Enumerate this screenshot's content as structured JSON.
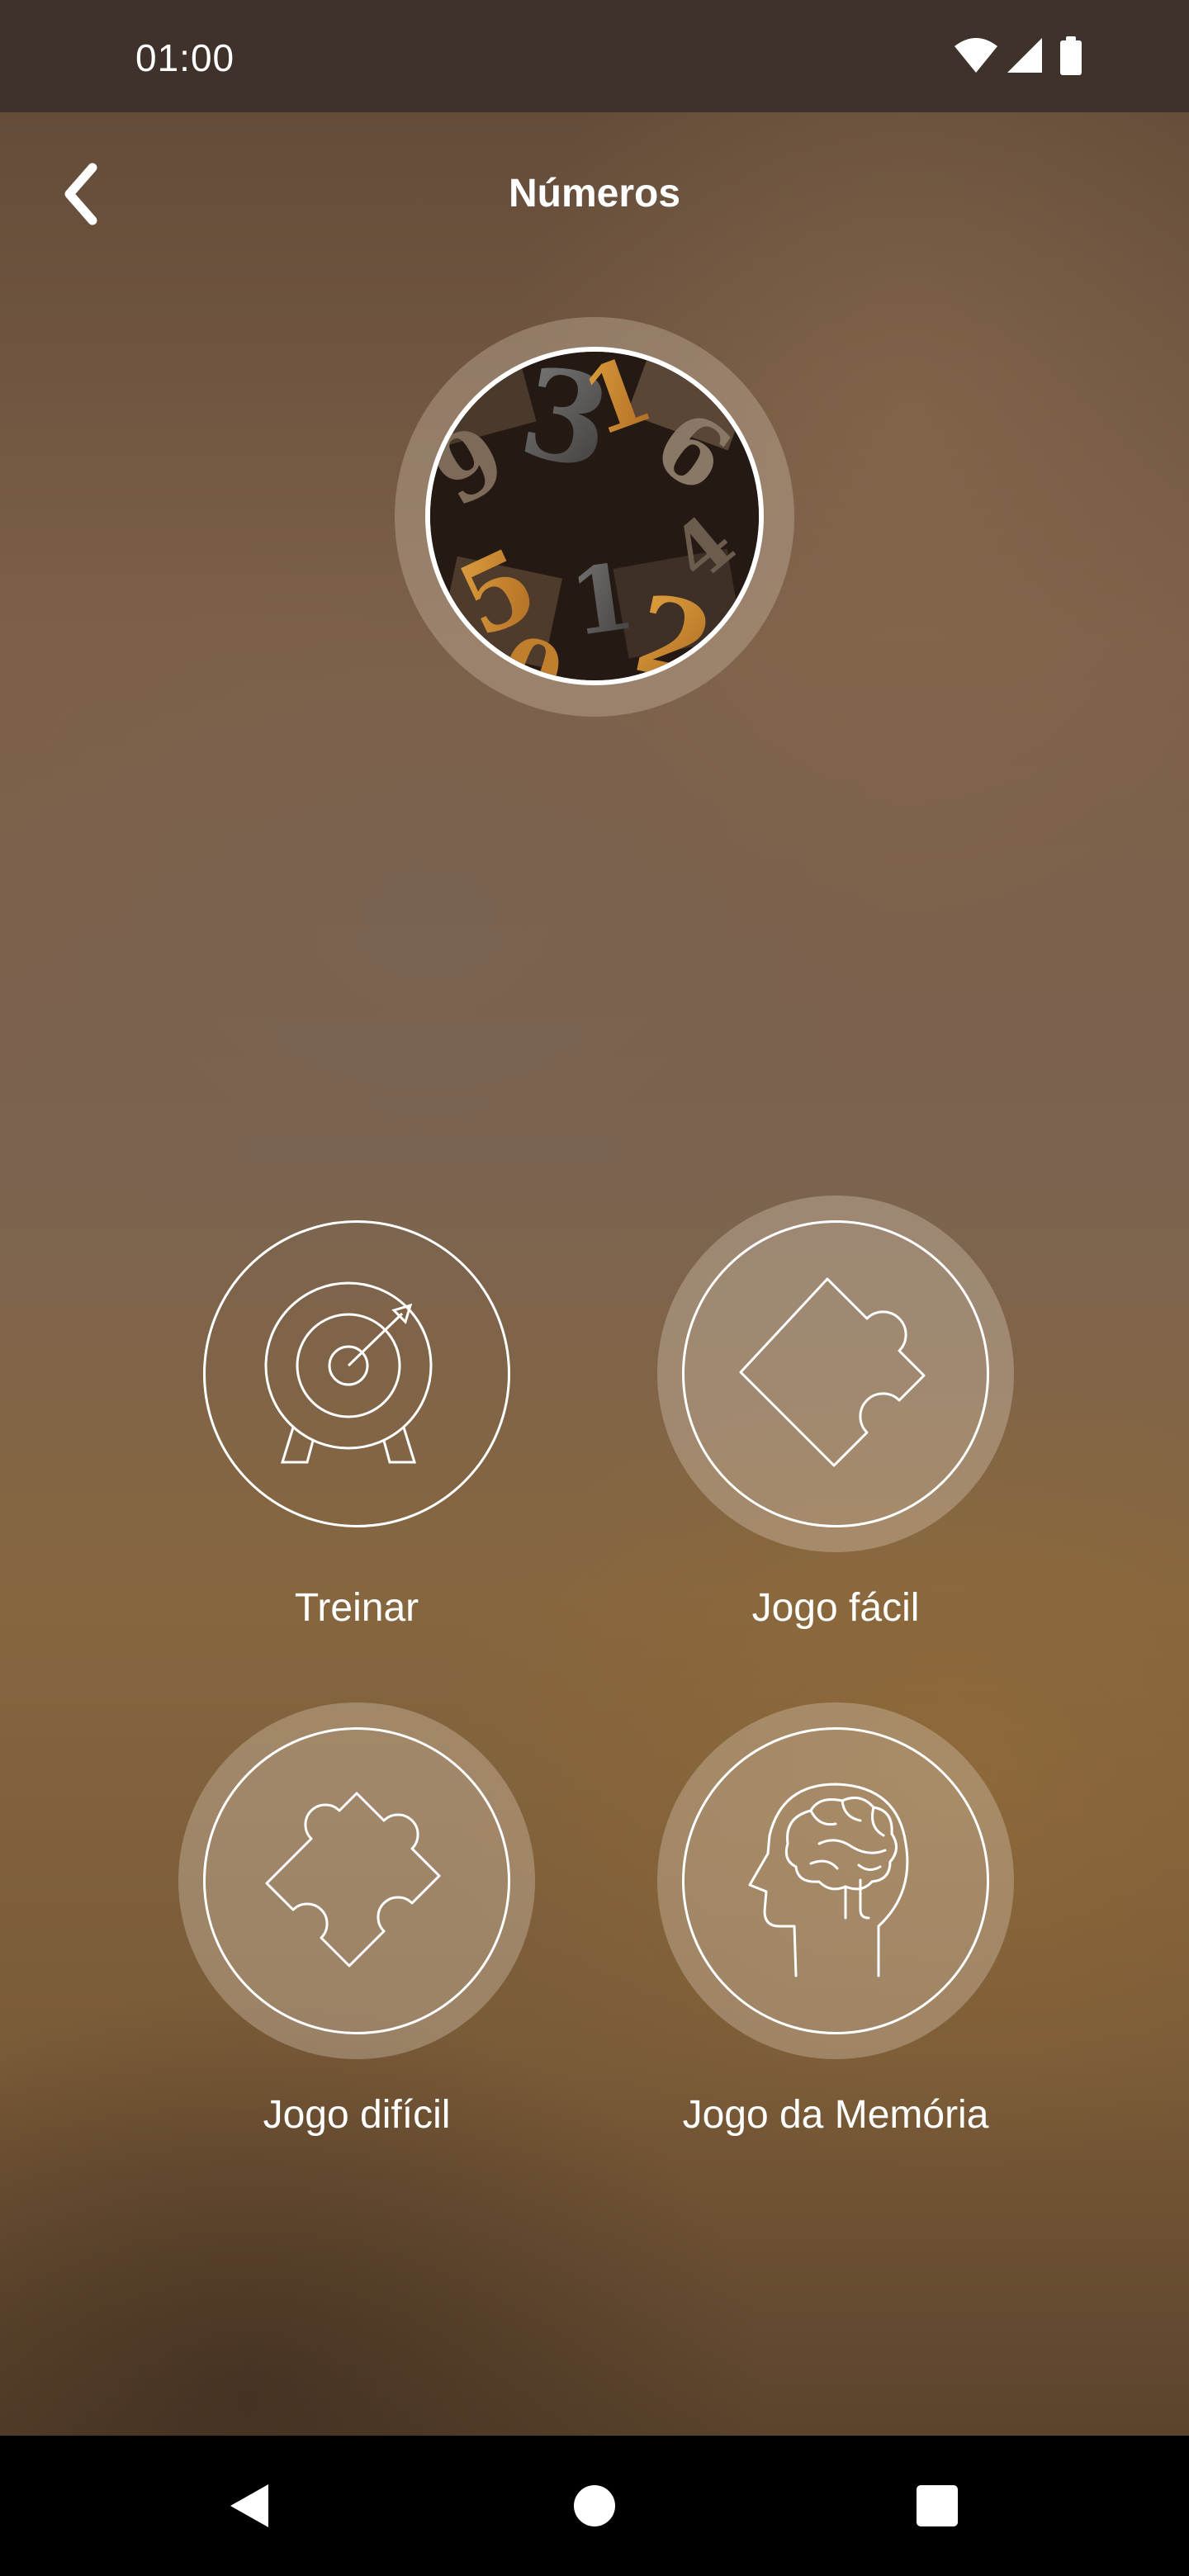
{
  "status_bar": {
    "time": "01:00",
    "icons": [
      "wifi-icon",
      "signal-icon",
      "battery-icon"
    ]
  },
  "header": {
    "title": "Números",
    "back_icon": "chevron-left-icon"
  },
  "category": {
    "image": "wooden-numbers-photo"
  },
  "options": [
    {
      "label": "Treinar",
      "icon": "target-icon"
    },
    {
      "label": "Jogo fácil",
      "icon": "puzzle-piece-icon"
    },
    {
      "label": "Jogo difícil",
      "icon": "puzzle-piece-complex-icon"
    },
    {
      "label": "Jogo da Memória",
      "icon": "brain-head-icon"
    }
  ],
  "nav_bar": {
    "icons": [
      "back-triangle-icon",
      "home-circle-icon",
      "recents-square-icon"
    ]
  },
  "colors": {
    "status_bar": "#3e322b",
    "nav_bar": "#000000",
    "text": "#ffffff"
  }
}
